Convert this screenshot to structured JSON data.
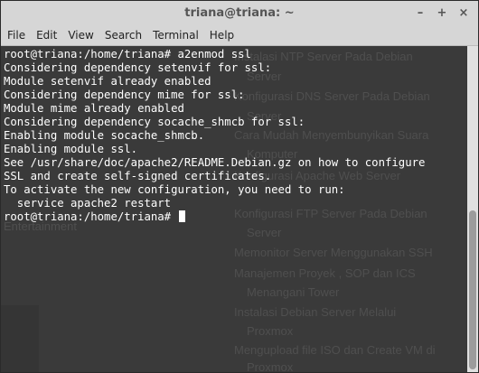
{
  "window": {
    "title": "triana@triana: ~",
    "minimize_label": "–",
    "maximize_label": "+",
    "close_label": "×"
  },
  "menu": {
    "items": [
      {
        "label": "File"
      },
      {
        "label": "Edit"
      },
      {
        "label": "View"
      },
      {
        "label": "Search"
      },
      {
        "label": "Terminal"
      },
      {
        "label": "Help"
      }
    ]
  },
  "terminal": {
    "lines": [
      "root@triana:/home/triana# a2enmod ssl",
      "Considering dependency setenvif for ssl:",
      "Module setenvif already enabled",
      "Considering dependency mime for ssl:",
      "Module mime already enabled",
      "Considering dependency socache_shmcb for ssl:",
      "Enabling module socache_shmcb.",
      "Enabling module ssl.",
      "See /usr/share/doc/apache2/README.Debian.gz on how to configure",
      "SSL and create self-signed certificates.",
      "To activate the new configuration, you need to run:",
      "  service apache2 restart"
    ],
    "prompt": "root@triana:/home/triana# "
  },
  "background_ghost": [
    "Instalasi NTP Server Pada Debian",
    "Server",
    "Konfigurasi DNS Server Pada Debian",
    "Server",
    "Cara Mudah Menyembunyikan Suara",
    "Komputer",
    "Konfigurasi Apache Web Server",
    "Konfigurasi FTP Server Pada Debian",
    "Server",
    "Memonitor Server Menggunakan SSH",
    "Manajemen Proyek , SOP dan ICS",
    "Menangani Tower",
    "Instalasi Debian Server Melalui",
    "Proxmox",
    "Mengupload file ISO dan Create VM di",
    "Proxmox",
    "Entertainment"
  ]
}
